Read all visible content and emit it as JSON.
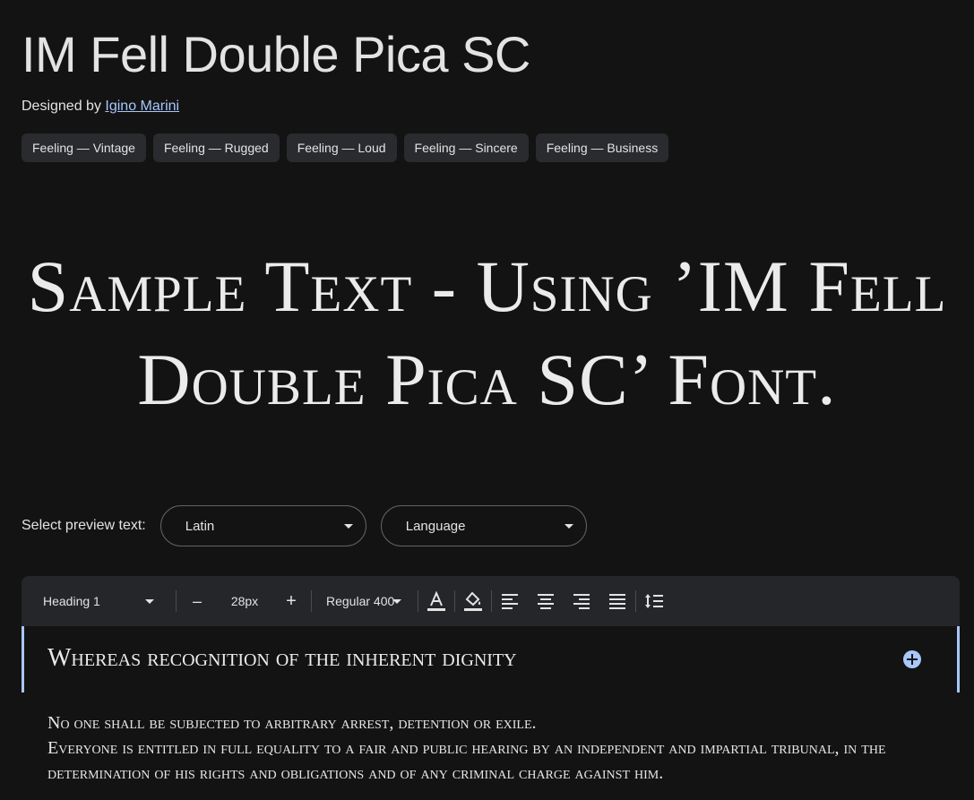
{
  "font": {
    "title": "IM Fell Double Pica SC",
    "designed_by_prefix": "Designed by",
    "designer": "Igino Marini"
  },
  "tags": [
    "Feeling — Vintage",
    "Feeling — Rugged",
    "Feeling — Loud",
    "Feeling — Sincere",
    "Feeling — Business"
  ],
  "sample_text": "Sample Text - Using ’IM Fell Double Pica SC’ Font.",
  "preview": {
    "label": "Select preview text:",
    "script_value": "Latin",
    "language_value": "Language"
  },
  "toolbar": {
    "style": "Heading 1",
    "decrease": "–",
    "size": "28px",
    "increase": "+",
    "weight": "Regular 400"
  },
  "editor": {
    "heading": "Whereas recognition of the inherent dignity",
    "body": [
      "No one shall be subjected to arbitrary arrest, detention or exile.",
      "Everyone is entitled in full equality to a fair and public hearing by an independent and impartial tribunal, in the determination of his rights and obligations and of any criminal charge against him."
    ]
  },
  "colors": {
    "background": "#131314",
    "text": "#e3e3e3",
    "accent": "#a8c7fa",
    "toolbar": "#252629",
    "chip": "#2a2b2e"
  },
  "icons": [
    "text-color-icon",
    "highlight-color-icon",
    "align-left-icon",
    "align-center-icon",
    "align-right-icon",
    "align-justify-icon",
    "line-spacing-icon",
    "add-circle-icon"
  ]
}
